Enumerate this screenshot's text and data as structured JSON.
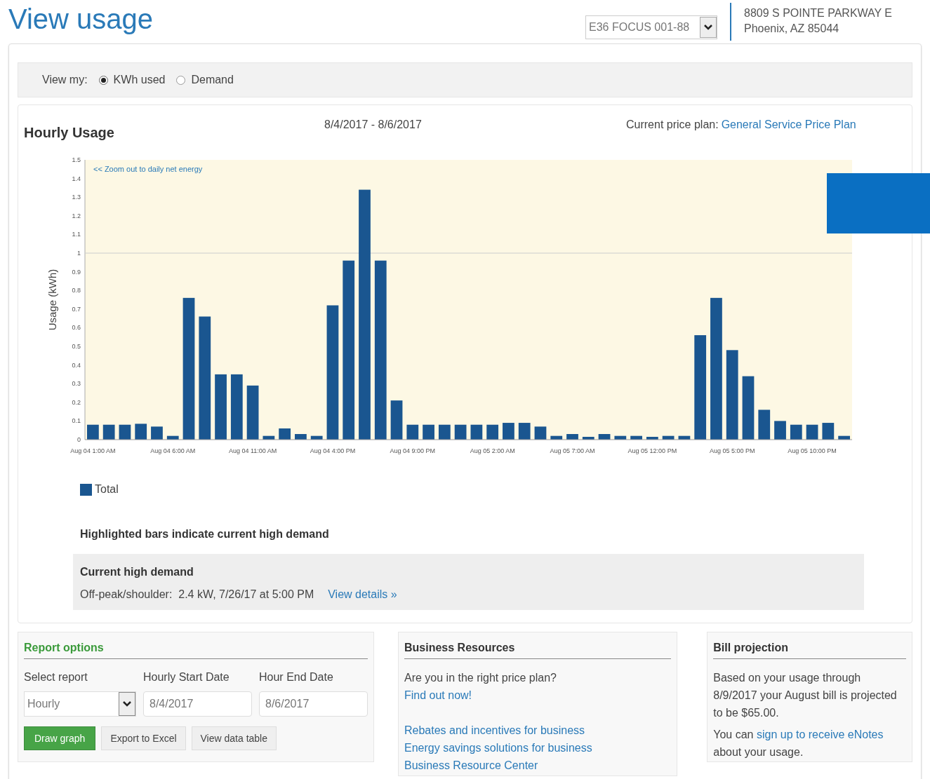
{
  "page_title": "View usage",
  "account": {
    "value": "E36 FOCUS 001-88"
  },
  "service_address": [
    "8809 S POINTE PARKWAY E",
    "Phoenix, AZ 85044"
  ],
  "view_my": {
    "label": "View my:",
    "options": [
      {
        "label": "KWh used",
        "selected": true
      },
      {
        "label": "Demand",
        "selected": false
      }
    ]
  },
  "usage": {
    "title": "Hourly Usage",
    "date_range": "8/4/2017 - 8/6/2017",
    "price_plan_label": "Current price plan:",
    "price_plan_link": "General Service Price Plan",
    "zoom_link": "<< Zoom out to daily net energy",
    "chart_data": {
      "type": "bar",
      "ylabel": "Usage (kWh)",
      "ylim": [
        0,
        1.5
      ],
      "yticks": [
        0,
        0.1,
        0.2,
        0.3,
        0.4,
        0.5,
        0.6,
        0.7,
        0.8,
        0.9,
        {
          "value": 1,
          "label": "1"
        },
        1.1,
        1.2,
        1.3,
        1.4,
        1.5
      ],
      "categories": [
        "Aug 04 1:00 AM",
        null,
        null,
        null,
        null,
        "Aug 04 6:00 AM",
        null,
        null,
        null,
        null,
        "Aug 04 11:00 AM",
        null,
        null,
        null,
        null,
        "Aug 04 4:00 PM",
        null,
        null,
        null,
        null,
        "Aug 04 9:00 PM",
        null,
        null,
        null,
        null,
        "Aug 05 2:00 AM",
        null,
        null,
        null,
        null,
        "Aug 05 7:00 AM",
        null,
        null,
        null,
        null,
        "Aug 05 12:00 PM",
        null,
        null,
        null,
        null,
        "Aug 05 5:00 PM",
        null,
        null,
        null,
        null,
        "Aug 05 10:00 PM",
        null,
        null
      ],
      "series": [
        {
          "name": "Total",
          "color": "#1a5690",
          "values": [
            0.08,
            0.08,
            0.08,
            0.085,
            0.07,
            0.02,
            0.76,
            0.66,
            0.35,
            0.35,
            0.29,
            0.02,
            0.06,
            0.03,
            0.02,
            0.72,
            0.96,
            1.34,
            0.96,
            0.21,
            0.08,
            0.08,
            0.08,
            0.08,
            0.08,
            0.08,
            0.09,
            0.09,
            0.07,
            0.02,
            0.03,
            0.015,
            0.03,
            0.02,
            0.02,
            0.015,
            0.02,
            0.02,
            0.56,
            0.76,
            0.48,
            0.34,
            0.16,
            0.1,
            0.08,
            0.08,
            0.09,
            0.02
          ]
        }
      ]
    },
    "highlight_note": "Highlighted bars indicate current high demand",
    "demand": {
      "title": "Current high demand",
      "text": "Off-peak/shoulder:  2.4 kW, 7/26/17 at 5:00 PM",
      "link": "View details »"
    }
  },
  "report_options": {
    "title": "Report options",
    "fields": [
      {
        "label": "Select report",
        "kind": "select",
        "value": "Hourly"
      },
      {
        "label": "Hourly Start Date",
        "kind": "text",
        "value": "8/4/2017"
      },
      {
        "label": "Hour End Date",
        "kind": "text",
        "value": "8/6/2017"
      }
    ],
    "buttons": [
      {
        "label": "Draw graph",
        "primary": true
      },
      {
        "label": "Export to Excel",
        "primary": false
      },
      {
        "label": "View data table",
        "primary": false
      }
    ]
  },
  "business_resources": {
    "title": "Business Resources",
    "question": "Are you in the right price plan?",
    "links": [
      "Find out now!",
      "Rebates and incentives for business",
      "Energy savings solutions for business",
      "Business Resource Center"
    ]
  },
  "bill_projection": {
    "title": "Bill projection",
    "text": "Based on your usage through 8/9/2017 your August bill is projected to be $65.00.",
    "enotes_before": "You can",
    "enotes_link": "sign up to receive eNotes",
    "enotes_after": "about your usage."
  }
}
